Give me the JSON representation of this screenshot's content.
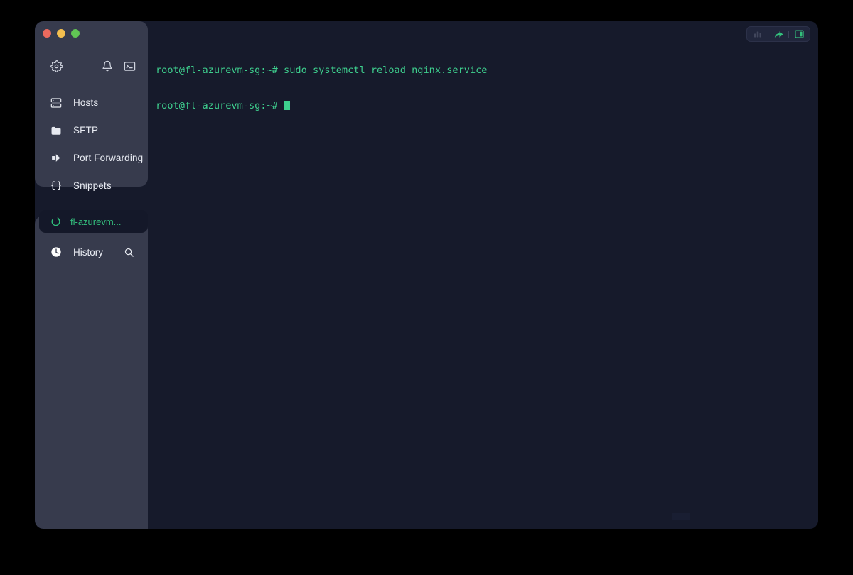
{
  "window": {
    "traffic_lights": [
      {
        "name": "close",
        "color": "#ec6a5e"
      },
      {
        "name": "minimize",
        "color": "#f4bf4f"
      },
      {
        "name": "maximize",
        "color": "#61c554"
      }
    ]
  },
  "sidebar": {
    "top_icons": [
      {
        "name": "settings",
        "icon": "gear-icon"
      },
      {
        "name": "notifications",
        "icon": "bell-icon"
      },
      {
        "name": "new-terminal",
        "icon": "terminal-icon"
      }
    ],
    "items": [
      {
        "label": "Hosts",
        "icon": "server-rack-icon"
      },
      {
        "label": "SFTP",
        "icon": "folder-icon"
      },
      {
        "label": "Port Forwarding",
        "icon": "arrow-forward-icon"
      },
      {
        "label": "Snippets",
        "icon": "braces-icon"
      }
    ],
    "session": {
      "label": "fl-azurevm...",
      "icon": "connection-ring-icon",
      "active": true,
      "accent": "#34c07e"
    },
    "history": {
      "label": "History",
      "icon": "clock-icon",
      "search_icon": "search-icon"
    }
  },
  "terminal": {
    "toolbar": [
      {
        "name": "stats",
        "icon": "stats-icon",
        "state": "disabled"
      },
      {
        "name": "share",
        "icon": "share-arrow-icon",
        "state": "enabled",
        "color": "#33c07c"
      },
      {
        "name": "split-pane",
        "icon": "split-pane-icon",
        "state": "enabled",
        "color": "#33c07c"
      }
    ],
    "lines": [
      "root@fl-azurevm-sg:~# sudo systemctl reload nginx.service",
      "root@fl-azurevm-sg:~# "
    ],
    "prompt": "root@fl-azurevm-sg:~#",
    "command": "sudo systemctl reload nginx.service",
    "cursor_visible": true,
    "text_color": "#3ecf8e",
    "background": "#161a2b"
  }
}
